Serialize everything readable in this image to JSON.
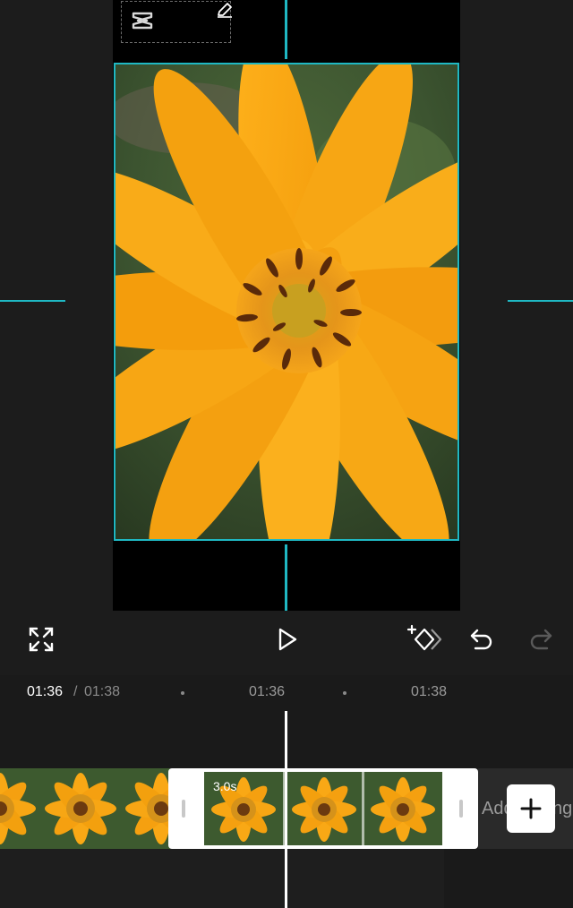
{
  "preview": {
    "logo_icon": "capcut-logo-icon",
    "edit_icon": "pencil-icon",
    "guide_color": "#1fb8c3"
  },
  "toolbar": {
    "fullscreen_icon": "fullscreen-icon",
    "play_icon": "play-icon",
    "keyframe_icon": "add-keyframe-icon",
    "undo_icon": "undo-icon",
    "redo_icon": "redo-icon"
  },
  "timeline": {
    "current_time": "01:36",
    "separator": "/",
    "total_time": "01:38",
    "ticks": [
      "01:36",
      "01:38"
    ],
    "selected_clip_duration": "3.0s",
    "ending_label": "Add ending",
    "add_icon": "plus-icon"
  }
}
